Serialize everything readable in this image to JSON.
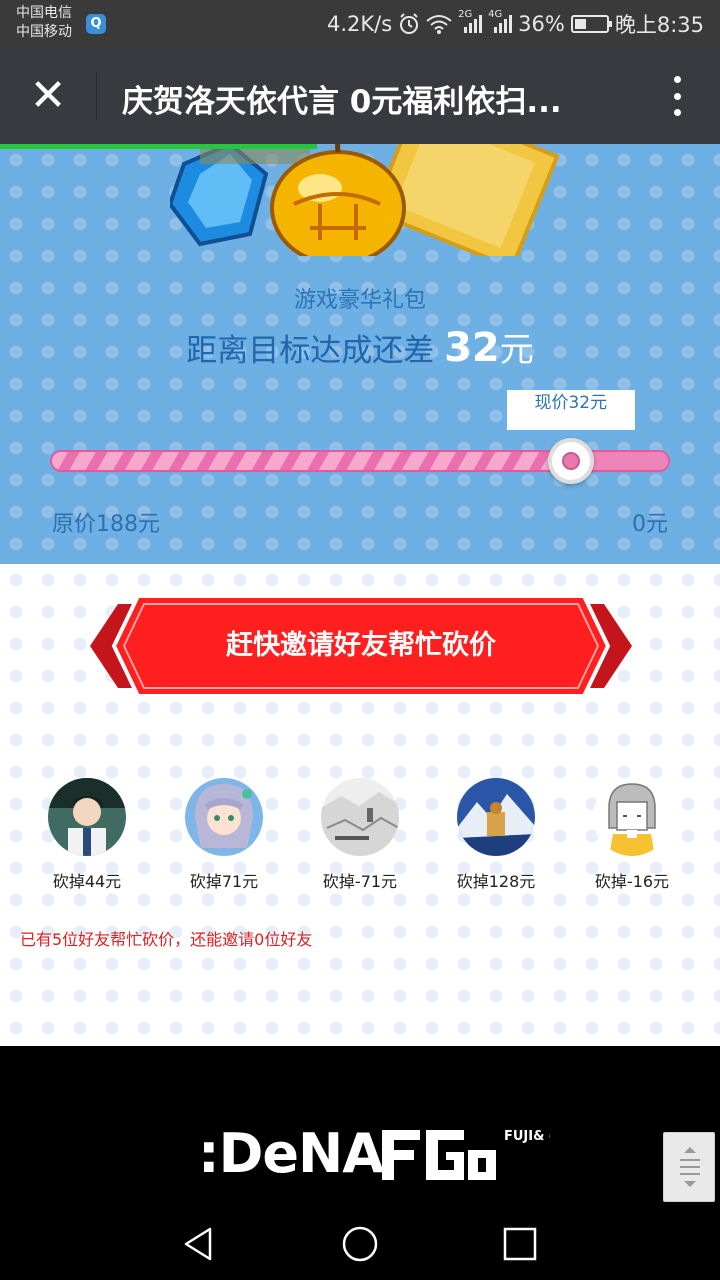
{
  "status_bar": {
    "carrier_1": "中国电信",
    "carrier_2": "中国移动",
    "net_speed": "4.2K/s",
    "signal_1_tag": "2G",
    "signal_2_tag": "4G",
    "battery": "36%",
    "time": "晚上8:35"
  },
  "app_bar": {
    "title": "庆贺洛天依代言 0元福利依扫...",
    "close_icon": "close-icon",
    "more_icon": "more-vertical-icon",
    "load_progress": 0.44
  },
  "bargain": {
    "gift_name": "游戏豪华礼包",
    "target_prefix": "距离目标达成还差",
    "remaining_amount": "32",
    "remaining_unit": "元",
    "current_price_label": "现价32元",
    "original_price_label": "原价188元",
    "min_price_label": "0元",
    "progress_fraction": 0.84
  },
  "invite": {
    "button_label": "赶快邀请好友帮忙砍价"
  },
  "friends": [
    {
      "cut_label": "砍掉44元"
    },
    {
      "cut_label": "砍掉71元"
    },
    {
      "cut_label": "砍掉-71元"
    },
    {
      "cut_label": "砍掉128元"
    },
    {
      "cut_label": "砍掉-16元"
    }
  ],
  "helper_note": "已有5位好友帮忙砍价，还能邀请0位好友",
  "footer": {
    "dena_logo": ":DeNA",
    "fgg_logo": "FUJI& gumi Games"
  },
  "colors": {
    "blue_bg": "#6eb0e4",
    "invite_red": "#e8141c",
    "load_green": "#22c83a",
    "slider_pink": "#e978af"
  }
}
